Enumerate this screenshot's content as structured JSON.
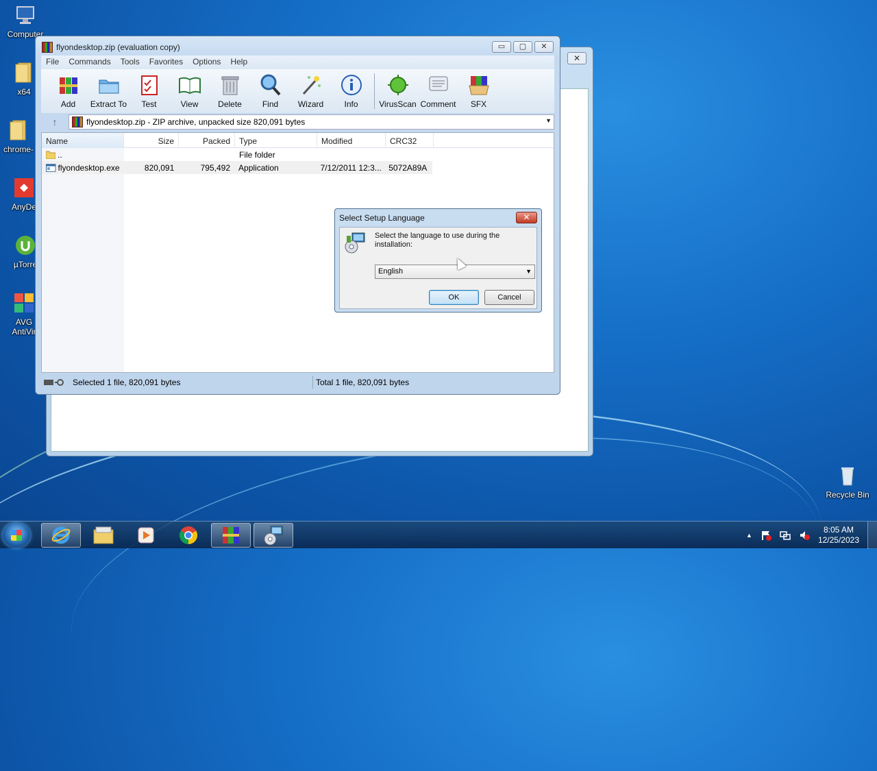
{
  "desktop": {
    "icons": [
      {
        "label": "Computer"
      },
      {
        "label": "x64"
      },
      {
        "label": "chrome-"
      },
      {
        "label": "AnyDe"
      },
      {
        "label": "µTorre"
      },
      {
        "label": "AVG"
      },
      {
        "label": "AntiVir"
      },
      {
        "label": "Recycle Bin"
      }
    ]
  },
  "background_window": {
    "close_glyph": "✕"
  },
  "winrar": {
    "title": "flyondesktop.zip (evaluation copy)",
    "caption": {
      "minimize": "▭",
      "maximize": "▢",
      "close": "✕"
    },
    "menu": [
      "File",
      "Commands",
      "Tools",
      "Favorites",
      "Options",
      "Help"
    ],
    "toolbar": [
      "Add",
      "Extract To",
      "Test",
      "View",
      "Delete",
      "Find",
      "Wizard",
      "Info",
      "VirusScan",
      "Comment",
      "SFX"
    ],
    "path": "flyondesktop.zip - ZIP archive, unpacked size 820,091 bytes",
    "up_glyph": "↑",
    "columns": [
      "Name",
      "Size",
      "Packed",
      "Type",
      "Modified",
      "CRC32"
    ],
    "rows": [
      {
        "name": "..",
        "size": "",
        "packed": "",
        "type": "File folder",
        "modified": "",
        "crc": ""
      },
      {
        "name": "flyondesktop.exe",
        "size": "820,091",
        "packed": "795,492",
        "type": "Application",
        "modified": "7/12/2011 12:3...",
        "crc": "5072A89A"
      }
    ],
    "status_left": "Selected 1 file, 820,091 bytes",
    "status_right": "Total 1 file, 820,091 bytes"
  },
  "dialog": {
    "title": "Select Setup Language",
    "message": "Select the language to use during the installation:",
    "selected_language": "English",
    "ok": "OK",
    "cancel": "Cancel"
  },
  "taskbar": {
    "time": "8:05 AM",
    "date": "12/25/2023",
    "tray_arrow": "▲"
  }
}
